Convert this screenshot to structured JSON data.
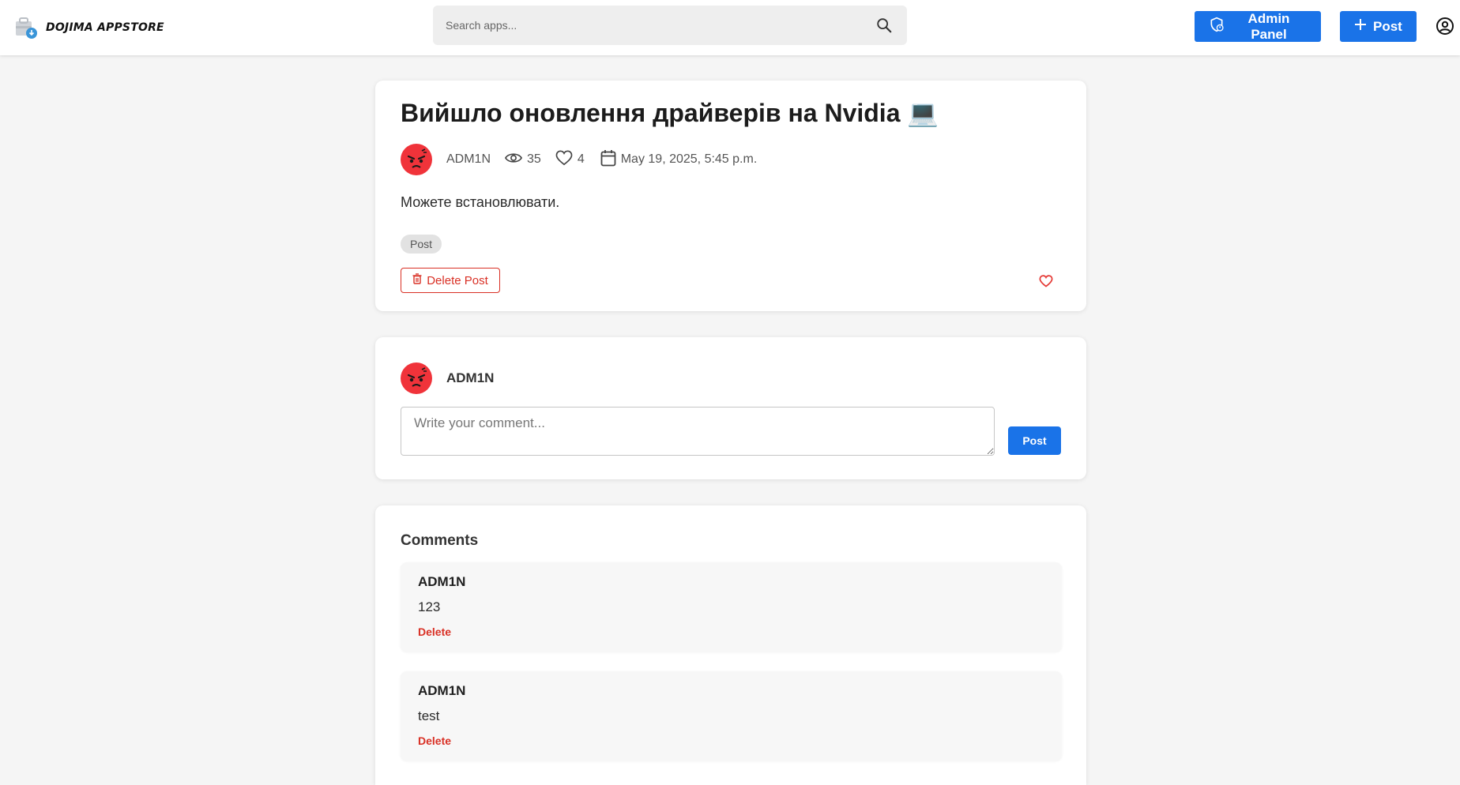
{
  "header": {
    "brand": "DOJIMA APPSTORE",
    "search_placeholder": "Search apps...",
    "admin_panel_label": "Admin Panel",
    "post_label": "Post"
  },
  "post": {
    "title": "Вийшло оновлення драйверів на Nvidia 💻",
    "author": "ADM1N",
    "views": "35",
    "likes": "4",
    "date": "May 19, 2025, 5:45 p.m.",
    "body": "Можете встановлювати.",
    "tag": "Post",
    "delete_label": "Delete Post"
  },
  "comment_form": {
    "user": "ADM1N",
    "placeholder": "Write your comment...",
    "post_label": "Post"
  },
  "comments": {
    "title": "Comments",
    "items": [
      {
        "author": "ADM1N",
        "text": "123",
        "delete_label": "Delete"
      },
      {
        "author": "ADM1N",
        "text": "test",
        "delete_label": "Delete"
      }
    ]
  },
  "colors": {
    "primary": "#1a73e8",
    "danger": "#d93025",
    "avatar": "#f0333a",
    "background": "#f5f5f5"
  },
  "icons": {
    "search": "search-icon",
    "admin": "admin-shield-icon",
    "add": "plus-icon",
    "account": "account-circle-icon",
    "views": "eye-icon",
    "likes": "heart-icon",
    "date": "calendar-icon",
    "delete": "trash-icon"
  }
}
